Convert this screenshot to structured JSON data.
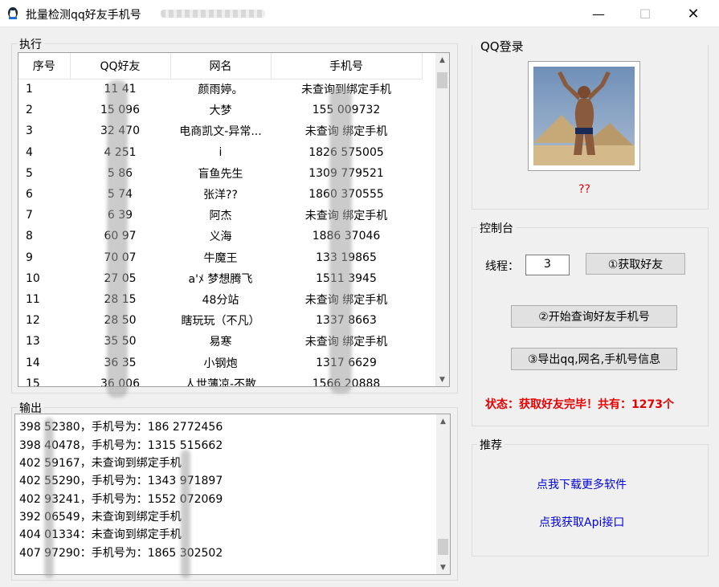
{
  "window": {
    "title": "批量检测qq好友手机号",
    "minimize": "—",
    "maximize": "☐",
    "close": "✕"
  },
  "exec_group": {
    "title": "执行"
  },
  "table": {
    "columns": [
      "序号",
      "QQ好友",
      "网名",
      "手机号"
    ],
    "rows": [
      {
        "no": "1",
        "qq": "11  41",
        "name": "颜雨婷。",
        "phone": "未查询到绑定手机"
      },
      {
        "no": "2",
        "qq": "15  096",
        "name": "大梦",
        "phone": "155 009732"
      },
      {
        "no": "3",
        "qq": "32  470",
        "name": "电商凯文-异常...",
        "phone": "未查询 绑定手机"
      },
      {
        "no": "4",
        "qq": "4  251",
        "name": "i",
        "phone": "1826 575005"
      },
      {
        "no": "5",
        "qq": "5  86",
        "name": "盲鱼先生",
        "phone": "1309 779521"
      },
      {
        "no": "6",
        "qq": "5  74",
        "name": "张洋??",
        "phone": "1860 370555"
      },
      {
        "no": "7",
        "qq": "6  39",
        "name": "阿杰",
        "phone": "未查询 绑定手机"
      },
      {
        "no": "8",
        "qq": "60  97",
        "name": "义海",
        "phone": "1886 37046"
      },
      {
        "no": "9",
        "qq": "70  07",
        "name": "牛魔王",
        "phone": "133  19865"
      },
      {
        "no": "10",
        "qq": "27  05",
        "name": "a'ﾒ  梦想腾飞",
        "phone": "1511  3945"
      },
      {
        "no": "11",
        "qq": "28  15",
        "name": "48分站",
        "phone": "未查询 绑定手机"
      },
      {
        "no": "12",
        "qq": "28  50",
        "name": "瞎玩玩（不凡）",
        "phone": "1337  8663"
      },
      {
        "no": "13",
        "qq": "35  50",
        "name": "易寒",
        "phone": "未查询 绑定手机"
      },
      {
        "no": "14",
        "qq": "36  35",
        "name": "小钢炮",
        "phone": "1317  6629"
      },
      {
        "no": "15",
        "qq": "36  006",
        "name": "人世薄凉-不散",
        "phone": "1566  20888"
      }
    ]
  },
  "output_group": {
    "title": "输出",
    "lines": [
      "398  52380，手机号为：186  2772456",
      "398  40478，手机号为：1315 515662",
      "402  59167，未查询到绑定手机",
      "402  55290，手机号为：1343 971897",
      "402  93241，手机号为：1552 072069",
      "392  06549，未查询到绑定手机",
      "404  01334：未查询到绑定手机",
      "407  97290：手机号为：1865 302502"
    ]
  },
  "login_group": {
    "title": "QQ登录",
    "nickname": "??"
  },
  "console_group": {
    "title": "控制台",
    "threads_label": "线程：",
    "threads_value": "3",
    "btn_get_friends": "①获取好友",
    "btn_query_phones": "②开始查询好友手机号",
    "btn_export": "③导出qq,网名,手机号信息",
    "status": "状态：获取好友完毕！共有：1273个"
  },
  "recommend_group": {
    "title": "推荐",
    "link_download": "点我下载更多软件",
    "link_api": "点我获取Api接口"
  },
  "colors": {
    "status_red": "#e60000",
    "link_blue": "#0000e0",
    "window_bg": "#f0f0f0"
  }
}
